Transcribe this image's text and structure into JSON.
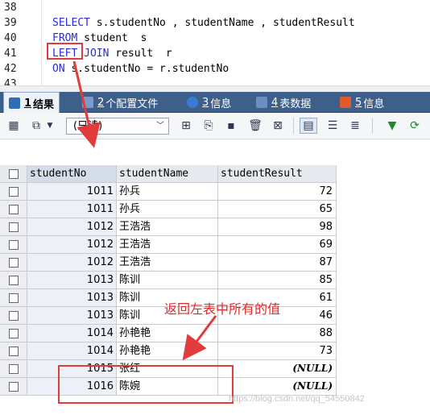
{
  "editor": {
    "lines": [
      {
        "num": "38",
        "tokens": []
      },
      {
        "num": "39",
        "tokens": [
          {
            "t": "SELECT",
            "kw": true
          },
          {
            "t": " s.studentNo , studentName , studentResult",
            "kw": false
          }
        ]
      },
      {
        "num": "40",
        "tokens": [
          {
            "t": "FROM",
            "kw": true
          },
          {
            "t": " student  s",
            "kw": false
          }
        ]
      },
      {
        "num": "41",
        "tokens": [
          {
            "t": "LEFT",
            "kw": true
          },
          {
            "t": " ",
            "kw": false
          },
          {
            "t": "JOIN",
            "kw": true
          },
          {
            "t": " result  r",
            "kw": false
          }
        ]
      },
      {
        "num": "42",
        "tokens": [
          {
            "t": "ON",
            "kw": true
          },
          {
            "t": " s.studentNo = r.studentNo",
            "kw": false
          }
        ]
      },
      {
        "num": "43",
        "tokens": []
      }
    ]
  },
  "tabs": [
    {
      "num": "1",
      "label": "结果",
      "icon_color": "#2f6db5"
    },
    {
      "num": "2",
      "label": "个配置文件",
      "icon_color": "#7a9cc6"
    },
    {
      "num": "3",
      "label": "信息",
      "icon_color": "#3a7bd5"
    },
    {
      "num": "4",
      "label": "表数据",
      "icon_color": "#6b8fc0"
    },
    {
      "num": "5",
      "label": "信息",
      "icon_color": "#e05a2b"
    }
  ],
  "toolbar": {
    "mode_select": "(只读)",
    "icons": [
      "add-row-icon",
      "export-icon",
      "dropdown-icon",
      "insert-row-icon",
      "duplicate-icon",
      "save-icon",
      "delete-icon",
      "cancel-icon",
      "grid-view-icon",
      "form-view-icon",
      "text-view-icon",
      "filter-icon",
      "refresh-icon"
    ]
  },
  "table": {
    "columns": [
      "studentNo",
      "studentName",
      "studentResult"
    ],
    "rows": [
      {
        "no": "1011",
        "name": "孙兵",
        "result": "72"
      },
      {
        "no": "1011",
        "name": "孙兵",
        "result": "65"
      },
      {
        "no": "1012",
        "name": "王浩浩",
        "result": "98"
      },
      {
        "no": "1012",
        "name": "王浩浩",
        "result": "69"
      },
      {
        "no": "1012",
        "name": "王浩浩",
        "result": "87"
      },
      {
        "no": "1013",
        "name": "陈训",
        "result": "85"
      },
      {
        "no": "1013",
        "name": "陈训",
        "result": "61"
      },
      {
        "no": "1013",
        "name": "陈训",
        "result": "46"
      },
      {
        "no": "1014",
        "name": "孙艳艳",
        "result": "88"
      },
      {
        "no": "1014",
        "name": "孙艳艳",
        "result": "73"
      },
      {
        "no": "1015",
        "name": "张红",
        "result": "(NULL)"
      },
      {
        "no": "1016",
        "name": "陈婉",
        "result": "(NULL)"
      }
    ]
  },
  "annotation": {
    "note": "返回左表中所有的值",
    "color": "#e23b3b"
  },
  "watermark": "https://blog.csdn.net/qq_54550842"
}
